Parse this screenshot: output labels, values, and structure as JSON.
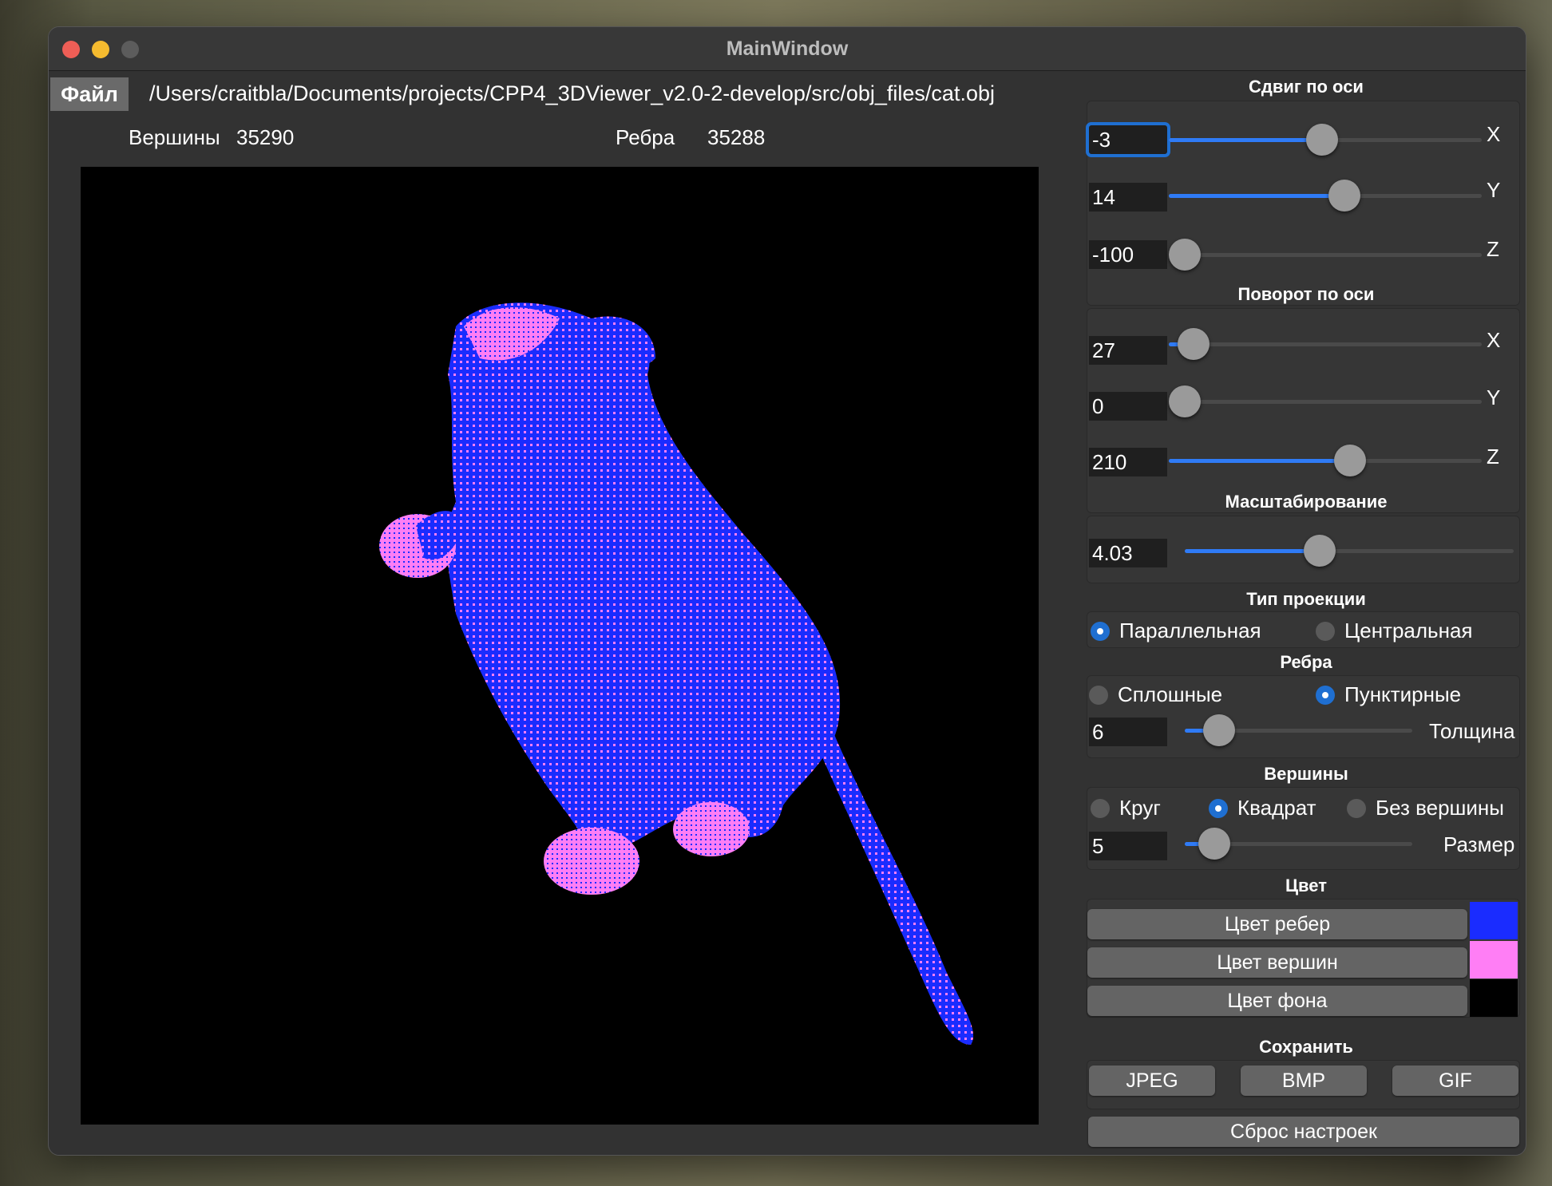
{
  "window": {
    "title": "MainWindow"
  },
  "menu": {
    "file": "Файл"
  },
  "file_path": "/Users/craitbla/Documents/projects/CPP4_3DViewer_v2.0-2-develop/src/obj_files/cat.obj",
  "stats": {
    "vertices_label": "Вершины",
    "vertices_value": "35290",
    "edges_label": "Ребра",
    "edges_value": "35288"
  },
  "translate": {
    "title": "Сдвиг по оси",
    "x": {
      "value": "-3",
      "axis": "X",
      "fraction": 0.49
    },
    "y": {
      "value": "14",
      "axis": "Y",
      "fraction": 0.56
    },
    "z": {
      "value": "-100",
      "axis": "Z",
      "fraction": 0.0
    }
  },
  "rotate": {
    "title": "Поворот по оси",
    "x": {
      "value": "27",
      "axis": "X",
      "fraction": 0.08
    },
    "y": {
      "value": "0",
      "axis": "Y",
      "fraction": 0.0
    },
    "z": {
      "value": "210",
      "axis": "Z",
      "fraction": 0.58
    }
  },
  "scale": {
    "title": "Масштабирование",
    "value": "4.03",
    "fraction": 0.41
  },
  "projection": {
    "title": "Тип проекции",
    "parallel": "Параллельная",
    "central": "Центральная",
    "selected": "parallel"
  },
  "edges": {
    "title": "Ребра",
    "solid": "Сплошные",
    "dashed": "Пунктирные",
    "selected": "dashed",
    "thickness_label": "Толщина",
    "thickness_value": "6",
    "thickness_fraction": 0.15
  },
  "vertices": {
    "title": "Вершины",
    "circle": "Круг",
    "square": "Квадрат",
    "none": "Без вершины",
    "selected": "square",
    "size_label": "Размер",
    "size_value": "5",
    "size_fraction": 0.13
  },
  "color": {
    "title": "Цвет",
    "edges_btn": "Цвет ребер",
    "vertices_btn": "Цвет вершин",
    "background_btn": "Цвет фона",
    "edge_color": "#1a2cff",
    "vertex_color": "#ff7ef5",
    "background_color": "#000000"
  },
  "save": {
    "title": "Сохранить",
    "jpeg": "JPEG",
    "bmp": "BMP",
    "gif": "GIF"
  },
  "reset": "Сброс настроек"
}
